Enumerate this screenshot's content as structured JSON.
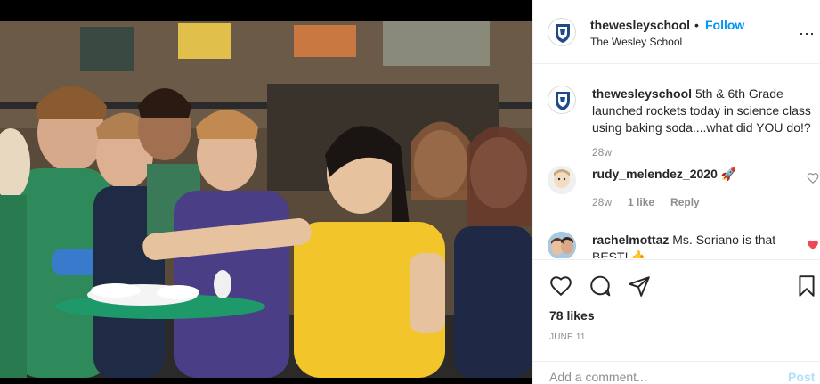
{
  "header": {
    "username": "thewesleyschool",
    "dot": "•",
    "follow_label": "Follow",
    "subtitle": "The Wesley School",
    "more_icon": "more-horizontal-icon"
  },
  "caption": {
    "username": "thewesleyschool",
    "line1": "5th & 6th Grade",
    "line2": "launched rockets today in science class",
    "line3": "using baking soda....what did YOU do!?",
    "time": "28w"
  },
  "comments": [
    {
      "username": "rudy_melendez_2020",
      "text": "🚀",
      "time": "28w",
      "likes": "1 like",
      "reply": "Reply",
      "liked": false
    },
    {
      "username": "rachelmottaz",
      "text": "Ms. Soriano is that",
      "text2": "BEST! 🤙",
      "liked": true
    }
  ],
  "actions": {
    "like_icon": "heart-icon",
    "comment_icon": "comment-icon",
    "share_icon": "share-icon",
    "save_icon": "bookmark-icon"
  },
  "likes": "78 likes",
  "date": "JUNE 11",
  "add_comment": {
    "placeholder": "Add a comment...",
    "post_label": "Post"
  },
  "colors": {
    "link_blue": "#0095f6",
    "post_disabled": "#b2dffc",
    "like_red": "#ed4956",
    "muted": "#8e8e8e"
  }
}
